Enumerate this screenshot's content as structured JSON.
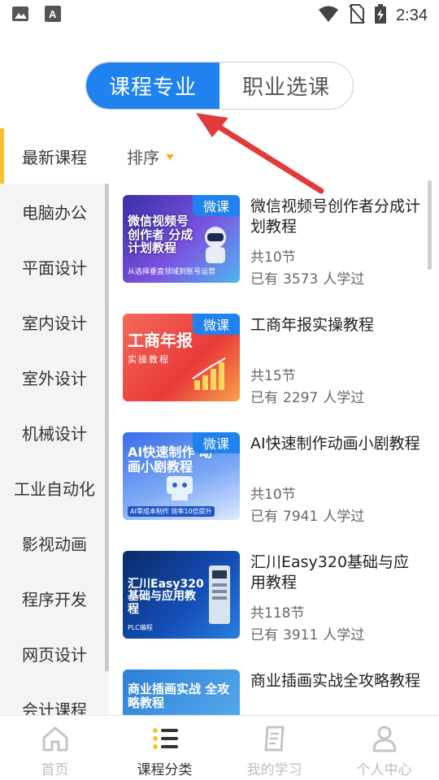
{
  "status_bar": {
    "time": "2:34"
  },
  "top_toggle": {
    "active": "课程专业",
    "inactive": "职业选课"
  },
  "sidebar": {
    "items": [
      {
        "label": "最新课程",
        "active": true
      },
      {
        "label": "电脑办公"
      },
      {
        "label": "平面设计"
      },
      {
        "label": "室内设计"
      },
      {
        "label": "室外设计"
      },
      {
        "label": "机械设计"
      },
      {
        "label": "工业自动化"
      },
      {
        "label": "影视动画"
      },
      {
        "label": "程序开发"
      },
      {
        "label": "网页设计"
      },
      {
        "label": "会计课程"
      }
    ]
  },
  "sort": {
    "label": "排序"
  },
  "colors": {
    "accent": "#1f82ee",
    "highlight": "#f5c12e",
    "arrow": "#e23a3a"
  },
  "courses": [
    {
      "title": "微信视频号创作者分成计划教程",
      "lessons_prefix": "共",
      "lessons": "10",
      "lessons_suffix": "节",
      "students_prefix": "已有",
      "students": "3573",
      "students_suffix": "人学过",
      "badge": "微课",
      "thumb_title": "微信视频号 创作者 分成计划教程",
      "thumb_sub": "从选择垂直领域到账号运营"
    },
    {
      "title": "工商年报实操教程",
      "lessons_prefix": "共",
      "lessons": "15",
      "lessons_suffix": "节",
      "students_prefix": "已有",
      "students": "2297",
      "students_suffix": "人学过",
      "badge": "微课",
      "thumb_title": "工商年报",
      "thumb_sub": "实操教程"
    },
    {
      "title": "AI快速制作动画小剧教程",
      "lessons_prefix": "共",
      "lessons": "10",
      "lessons_suffix": "节",
      "students_prefix": "已有",
      "students": "7941",
      "students_suffix": "人学过",
      "badge": "微课",
      "thumb_title": "AI快速制作 动画小剧教程",
      "thumb_sub": "AI零成本制作 效率10倍提升"
    },
    {
      "title": "汇川Easy320基础与应用教程",
      "lessons_prefix": "共",
      "lessons": "118",
      "lessons_suffix": "节",
      "students_prefix": "已有",
      "students": "3911",
      "students_suffix": "人学过",
      "badge": "",
      "thumb_title": "汇川Easy320 基础与应用教程",
      "thumb_sub": "PLC编程"
    },
    {
      "title": "商业插画实战全攻略教程",
      "lessons_prefix": "",
      "lessons": "",
      "lessons_suffix": "",
      "students_prefix": "",
      "students": "",
      "students_suffix": "",
      "badge": "",
      "thumb_title": "商业插画实战 全攻略教程",
      "thumb_sub": ""
    }
  ],
  "tabbar": {
    "items": [
      {
        "label": "首页",
        "icon": "home-icon"
      },
      {
        "label": "课程分类",
        "icon": "category-list-icon",
        "active": true
      },
      {
        "label": "我的学习",
        "icon": "study-book-icon"
      },
      {
        "label": "个人中心",
        "icon": "person-icon"
      }
    ]
  }
}
